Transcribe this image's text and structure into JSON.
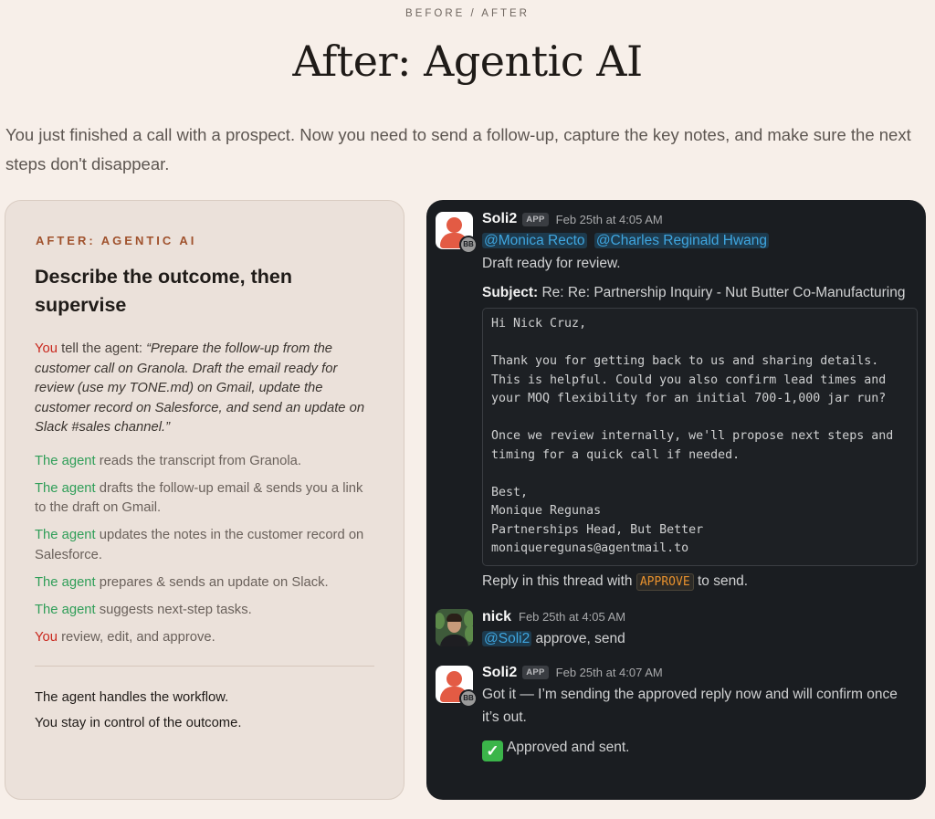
{
  "page": {
    "eyebrow": "BEFORE / AFTER",
    "title": "After: Agentic AI",
    "intro": "You just finished a call with a prospect. Now you need to send a follow-up, capture the key notes, and make sure the next steps don't disappear."
  },
  "card": {
    "eyebrow": "AFTER: AGENTIC AI",
    "heading": "Describe the outcome, then supervise",
    "instruction": {
      "actor": "You",
      "lead": " tell the agent: ",
      "quote": "“Prepare the follow-up from the customer call on Granola. Draft the email ready for review (use my TONE.md) on Gmail, update the customer record on Salesforce, and send an update on Slack #sales channel.”"
    },
    "steps": [
      {
        "actor": "The agent",
        "text": " reads the transcript from Granola."
      },
      {
        "actor": "The agent",
        "text": " drafts the follow-up email & sends you a link to the draft on Gmail."
      },
      {
        "actor": "The agent",
        "text": " updates the notes in the customer record on Salesforce."
      },
      {
        "actor": "The agent",
        "text": " prepares & sends an update on Slack."
      },
      {
        "actor": "The agent",
        "text": " suggests next-step tasks."
      },
      {
        "actor": "You",
        "text": " review, edit, and approve."
      }
    ],
    "closing": [
      "The agent handles the workflow.",
      "You stay in control of the outcome."
    ]
  },
  "slack": {
    "msg1": {
      "sender": "Soli2",
      "tag": "APP",
      "time": "Feb 25th at 4:05 AM",
      "badge": "BB",
      "mention1": "@Monica Recto",
      "mention2": "@Charles Reginald Hwang",
      "line1": "Draft ready for review.",
      "subject_label": "Subject:",
      "subject": " Re: Re: Partnership Inquiry - Nut Butter Co-Manufacturing",
      "email": {
        "greeting": "Hi Nick Cruz,",
        "p1": [
          "Thank you for getting back to us and sharing details.",
          "This is helpful. Could you also confirm lead times and",
          "your MOQ flexibility for an initial 700-1,000 jar run?"
        ],
        "p2": [
          "Once we review internally, we'll propose next steps and",
          "timing for a quick call if needed."
        ],
        "sign": [
          "Best,",
          "Monique Regunas",
          "Partnerships Head, But Better",
          "moniqueregunas@agentmail.to"
        ]
      },
      "reply_pre": "Reply in this thread with ",
      "reply_code": "APPROVE",
      "reply_post": " to send."
    },
    "msg2": {
      "sender": "nick",
      "time": "Feb 25th at 4:05 AM",
      "mention": "@Soli2",
      "text": " approve, send"
    },
    "msg3": {
      "sender": "Soli2",
      "tag": "APP",
      "time": "Feb 25th at 4:07 AM",
      "badge": "BB",
      "text": "Got it — I’m sending the approved reply now and will confirm once it’s out.",
      "status_icon": "✓",
      "status": "Approved and sent."
    }
  }
}
